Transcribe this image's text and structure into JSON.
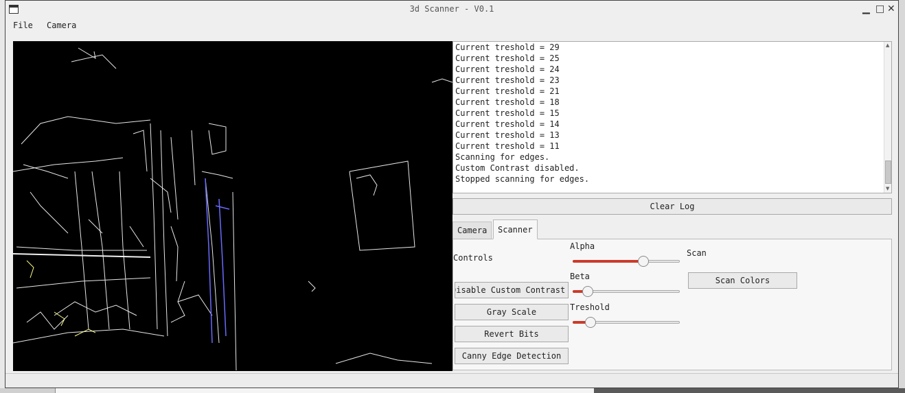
{
  "window": {
    "title": "3d Scanner - V0.1",
    "controls": {
      "minimize": "▁",
      "maximize": "□",
      "close": "✕"
    }
  },
  "menu": {
    "file": "File",
    "camera": "Camera"
  },
  "log": {
    "lines": [
      "Current treshold = 29",
      "Current treshold = 25",
      "Current treshold = 24",
      "Current treshold = 23",
      "Current treshold = 21",
      "Current treshold = 18",
      "Current treshold = 15",
      "Current treshold = 14",
      "Current treshold = 13",
      "Current treshold = 11",
      "Scanning for edges.",
      "Custom Contrast disabled.",
      "Stopped scanning for edges."
    ],
    "clear_label": "Clear Log"
  },
  "tabs": {
    "camera": "Camera",
    "scanner": "Scanner",
    "active": "Scanner"
  },
  "scanner": {
    "controls_label": "Controls",
    "buttons": {
      "disable_contrast": "Disable Custom Contrast",
      "gray_scale": "Gray Scale",
      "revert_bits": "Revert Bits",
      "canny": "Canny Edge Detection"
    },
    "sliders": {
      "alpha": {
        "label": "Alpha",
        "fraction": 0.68
      },
      "beta": {
        "label": "Beta",
        "fraction": 0.1
      },
      "treshold": {
        "label": "Treshold",
        "fraction": 0.13
      }
    },
    "scan_label": "Scan",
    "scan_colors": "Scan Colors"
  },
  "colors": {
    "accent": "#cc3a2a",
    "camera_background": "#000000"
  }
}
